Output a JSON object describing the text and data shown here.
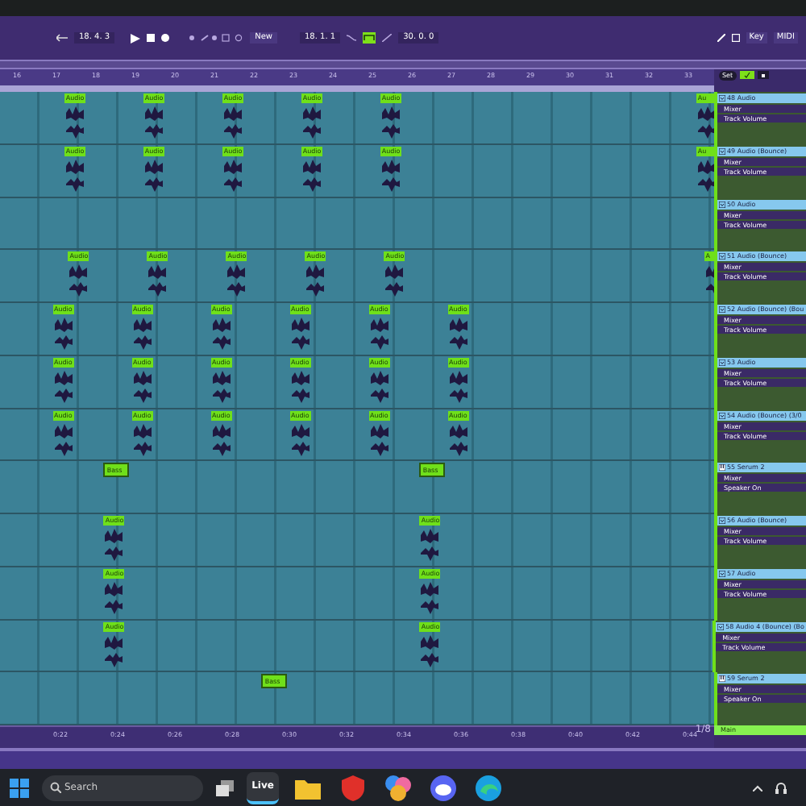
{
  "transport": {
    "position": "18. 4. 3",
    "draw_mode": "New",
    "loop_start": "18. 1. 1",
    "loop_length": "30. 0. 0",
    "key": "Key",
    "midi": "MIDI",
    "follow_on": true
  },
  "ruler": {
    "bars": [
      "16",
      "17",
      "18",
      "19",
      "20",
      "21",
      "22",
      "23",
      "24",
      "25",
      "26",
      "27",
      "28",
      "29",
      "30",
      "31",
      "32",
      "33"
    ],
    "set": "Set"
  },
  "tracks": [
    {
      "name": "48 Audio",
      "device": "Mixer",
      "param": "Track Volume",
      "kind": "audio",
      "clips": [
        {
          "name": "Audio"
        },
        {
          "name": "Audio"
        },
        {
          "name": "Audio"
        },
        {
          "name": "Audio"
        },
        {
          "name": "Audio"
        },
        {
          "name": "Au"
        }
      ]
    },
    {
      "name": "49 Audio (Bounce)",
      "device": "Mixer",
      "param": "Track Volume",
      "kind": "audio",
      "clips": [
        {
          "name": "Audio"
        },
        {
          "name": "Audio"
        },
        {
          "name": "Audio"
        },
        {
          "name": "Audio"
        },
        {
          "name": "Audio"
        },
        {
          "name": "Au"
        }
      ]
    },
    {
      "name": "50 Audio",
      "device": "Mixer",
      "param": "Track Volume",
      "kind": "audio"
    },
    {
      "name": "51 Audio (Bounce)",
      "device": "Mixer",
      "param": "Track Volume",
      "kind": "audio",
      "clips": [
        {
          "name": "Audio"
        },
        {
          "name": "Audio"
        },
        {
          "name": "Audio"
        },
        {
          "name": "Audio"
        },
        {
          "name": "Audio"
        },
        {
          "name": "A"
        }
      ]
    },
    {
      "name": "52 Audio (Bounce) (Bou",
      "device": "Mixer",
      "param": "Track Volume",
      "kind": "audio",
      "clips": [
        {
          "name": "Audio"
        },
        {
          "name": "Audio"
        },
        {
          "name": "Audio"
        },
        {
          "name": "Audio"
        },
        {
          "name": "Audio"
        },
        {
          "name": "Audio"
        }
      ]
    },
    {
      "name": "53 Audio",
      "device": "Mixer",
      "param": "Track Volume",
      "kind": "audio",
      "clips": [
        {
          "name": "Audio"
        },
        {
          "name": "Audio"
        },
        {
          "name": "Audio"
        },
        {
          "name": "Audio"
        },
        {
          "name": "Audio"
        },
        {
          "name": "Audio"
        }
      ]
    },
    {
      "name": "54 Audio (Bounce) (3/0",
      "device": "Mixer",
      "param": "Track Volume",
      "kind": "audio",
      "clips": [
        {
          "name": "Audio"
        },
        {
          "name": "Audio"
        },
        {
          "name": "Audio"
        },
        {
          "name": "Audio"
        },
        {
          "name": "Audio"
        },
        {
          "name": "Audio"
        }
      ]
    },
    {
      "name": "55 Serum 2",
      "device": "Mixer",
      "param": "Speaker On",
      "kind": "midi",
      "clips": [
        {
          "name": "Bass"
        },
        {
          "name": "Bass"
        }
      ]
    },
    {
      "name": "56 Audio (Bounce)",
      "device": "Mixer",
      "param": "Track Volume",
      "kind": "audio",
      "clips": [
        {
          "name": "Audio"
        },
        {
          "name": "Audio"
        }
      ]
    },
    {
      "name": "57 Audio",
      "device": "Mixer",
      "param": "Track Volume",
      "kind": "audio",
      "clips": [
        {
          "name": "Audio"
        },
        {
          "name": "Audio"
        }
      ]
    },
    {
      "name": "58 Audio 4 (Bounce) (Bo",
      "device": "Mixer",
      "param": "Track Volume",
      "kind": "audio",
      "clips": [
        {
          "name": "Audio"
        },
        {
          "name": "Audio"
        }
      ]
    },
    {
      "name": "59 Serum 2",
      "device": "Mixer",
      "param": "Speaker On",
      "kind": "midi",
      "clips": [
        {
          "name": "Bass"
        }
      ]
    }
  ],
  "main": {
    "name": "Main"
  },
  "time_ruler": {
    "labels": [
      "0:22",
      "0:24",
      "0:26",
      "0:28",
      "0:30",
      "0:32",
      "0:34",
      "0:36",
      "0:38",
      "0:40",
      "0:42",
      "0:44"
    ],
    "grid": "1/8"
  },
  "taskbar": {
    "search": {
      "placeholder": "Search"
    },
    "apps": [
      {
        "kind": "live",
        "label": "Live",
        "selected": true
      },
      {
        "kind": "folder",
        "selected": false
      },
      {
        "kind": "shield",
        "selected": false
      },
      {
        "kind": "copilot",
        "selected": false
      },
      {
        "kind": "discord",
        "selected": false
      },
      {
        "kind": "edge",
        "selected": false
      }
    ]
  }
}
